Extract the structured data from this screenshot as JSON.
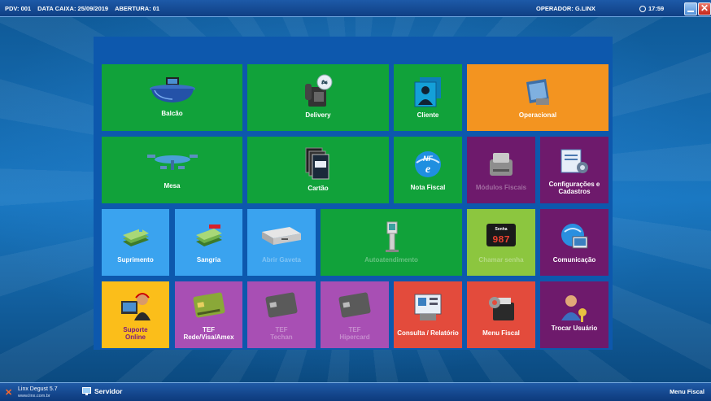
{
  "topbar": {
    "pdv": "PDV: 001",
    "data_caixa": "DATA CAIXA: 25/09/2019",
    "abertura": "ABERTURA: 01",
    "operador": "OPERADOR: G.LINX",
    "time": "17:59"
  },
  "tiles": {
    "balcao": "Balcão",
    "delivery": "Delivery",
    "cliente": "Cliente",
    "operacional": "Operacional",
    "mesa": "Mesa",
    "cartao": "Cartão",
    "nota_fiscal": "Nota Fiscal",
    "modulos_fiscais": "Módulos Fiscais",
    "configuracoes_1": "Configurações e",
    "configuracoes_2": "Cadastros",
    "suprimento": "Suprimento",
    "sangria": "Sangria",
    "abrir_gaveta": "Abrir Gaveta",
    "autoatendimento": "Autoatendimento",
    "chamar_senha": "Chamar senha",
    "senha_display": "987",
    "senha_caption": "Senha",
    "comunicacao": "Comunicação",
    "suporte_1": "Suporte",
    "suporte_2": "Online",
    "tef_rede_1": "TEF",
    "tef_rede_2": "Rede/Visa/Amex",
    "tef_techan_1": "TEF",
    "tef_techan_2": "Techan",
    "tef_hiper_1": "TEF",
    "tef_hiper_2": "Hipercard",
    "consulta": "Consulta / Relatório",
    "menu_fiscal": "Menu Fiscal",
    "trocar_usuario": "Trocar Usuário"
  },
  "statusbar": {
    "app_name": "Linx Degust 5.7",
    "url": "www.linx.com.br",
    "server": "Servidor",
    "menu_fiscal": "Menu Fiscal"
  }
}
